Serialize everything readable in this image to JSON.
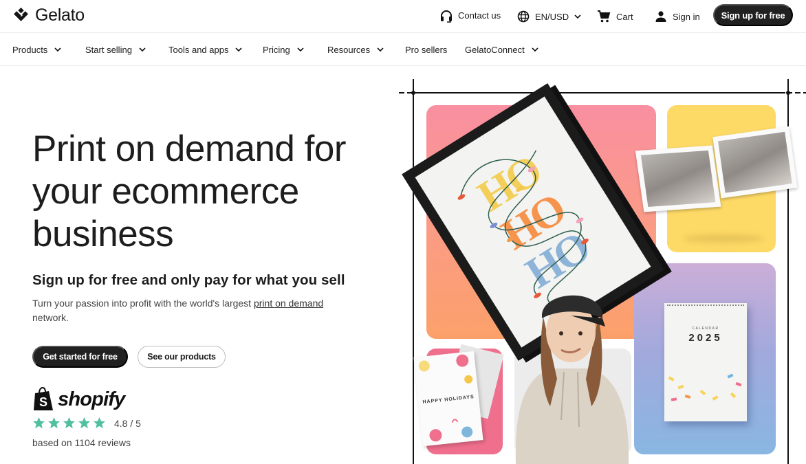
{
  "brand": {
    "name": "Gelato"
  },
  "utility_bar": {
    "contact_label": "Contact us",
    "locale_label": "EN/USD",
    "cart_label": "Cart",
    "signin_label": "Sign in",
    "signup_label": "Sign up for free"
  },
  "nav": {
    "items": [
      {
        "label": "Products",
        "has_dropdown": true
      },
      {
        "label": "Start selling",
        "has_dropdown": true
      },
      {
        "label": "Tools and apps",
        "has_dropdown": true
      },
      {
        "label": "Pricing",
        "has_dropdown": true
      },
      {
        "label": "Resources",
        "has_dropdown": true
      },
      {
        "label": "Pro sellers",
        "has_dropdown": false
      },
      {
        "label": "GelatoConnect",
        "has_dropdown": true
      }
    ]
  },
  "hero": {
    "title": "Print on demand for your ecommerce business",
    "subtitle": "Sign up for free and only pay for what you sell",
    "description_prefix": "Turn your passion into profit with the world's largest ",
    "description_link": "print on demand",
    "description_suffix": " network.",
    "primary_cta": "Get started for free",
    "secondary_cta": "See our products"
  },
  "review": {
    "platform": "shopify",
    "stars": 5,
    "rating_text": "4.8 / 5",
    "count_text": "based on 1104 reviews",
    "star_color": "#4fbf9f"
  },
  "collage": {
    "poster_text": [
      "HO",
      "HO",
      "HO"
    ],
    "card_text": "HAPPY HOLIDAYS",
    "calendar_label": "CALENDAR",
    "calendar_year": "2025"
  },
  "colors": {
    "primary_button": "#212121",
    "text": "#1d1d1d",
    "border": "#ececec"
  }
}
